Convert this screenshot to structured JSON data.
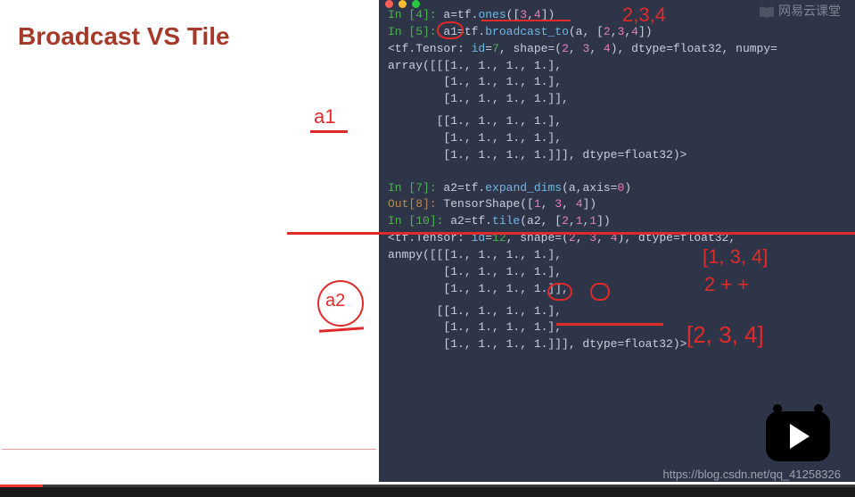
{
  "slide": {
    "title": "Broadcast VS Tile"
  },
  "annotations": {
    "a1": "a1",
    "a2": "a2",
    "shape1": "2,3,4",
    "shape2": "[1, 3, 4]",
    "expr": "2 + +",
    "shape3": "[2, 3, 4]"
  },
  "terminal": {
    "lines": {
      "in4_prompt": "In [4]: ",
      "in4_code_a": "a",
      "in4_code_eq": "=tf.",
      "in4_code_fn": "ones",
      "in4_code_args": "([",
      "in4_n1": "3",
      "in4_c1": ",",
      "in4_n2": "4",
      "in4_close": "])",
      "in5_prompt": "In [5]: ",
      "in5_a1": "a1",
      "in5_mid": "=tf.",
      "in5_fn": "broadcast_to",
      "in5_open": "(a, [",
      "in5_n1": "2",
      "in5_c1": ",",
      "in5_n2": "3",
      "in5_c2": ",",
      "in5_n3": "4",
      "in5_close": "])",
      "tensor1a": "<tf.Tensor: ",
      "tensor1_id_l": "id",
      "tensor1_id_eq": "=",
      "tensor1_id_v": "7",
      "tensor1_mid": ", shape=(",
      "tensor1_s1": "2",
      "tensor1_sc1": ", ",
      "tensor1_s2": "3",
      "tensor1_sc2": ", ",
      "tensor1_s3": "4",
      "tensor1_end": "), dtype=float32, numpy=",
      "arr1_l1": "array([[[1., 1., 1., 1.],",
      "arr1_l2": "        [1., 1., 1., 1.],",
      "arr1_l3": "        [1., 1., 1., 1.]],",
      "arr1_l4": "       [[1., 1., 1., 1.],",
      "arr1_l5": "        [1., 1., 1., 1.],",
      "arr1_l6": "        [1., 1., 1., 1.]]], dtype=float32)>",
      "in7_prompt": "In [7]: ",
      "in7_code": "a2=tf.",
      "in7_fn": "expand_dims",
      "in7_args": "(a,axis=",
      "in7_n": "0",
      "in7_close": ")",
      "out8_prompt": "Out[8]: ",
      "out8_txt": "TensorShape([",
      "out8_n1": "1",
      "out8_c1": ", ",
      "out8_n2": "3",
      "out8_c2": ", ",
      "out8_n3": "4",
      "out8_close": "])",
      "in10_prompt": "In [10]: ",
      "in10_code": "a2=tf.",
      "in10_fn": "tile",
      "in10_open": "(a2, [",
      "in10_n1": "2",
      "in10_c1": ",",
      "in10_n2": "1",
      "in10_c2": ",",
      "in10_n3": "1",
      "in10_close": "])",
      "tensor2a": "<tf.Tensor: ",
      "tensor2_id_l": "id",
      "tensor2_id_eq": "=",
      "tensor2_id_v": "12",
      "tensor2_mid": ", shape=(",
      "tensor2_s1": "2",
      "tensor2_sc1": ", ",
      "tensor2_s2": "3",
      "tensor2_sc2": ", ",
      "tensor2_s3": "4",
      "tensor2_end": "), dtype=float32,",
      "arr2_l0": "anmpy([[[1., 1., 1., 1.],",
      "arr2_l1": "        [1., 1., 1., 1.],",
      "arr2_l2": "        [1., 1., 1., 1.]],",
      "arr2_l3": "       [[1., 1., 1., 1.],",
      "arr2_l4": "        [1., 1., 1., 1.],",
      "arr2_l5": "        [1., 1., 1., 1.]]], dtype=float32)>"
    }
  },
  "watermark": "网易云课堂",
  "source_url": "https://blog.csdn.net/qq_41258326"
}
